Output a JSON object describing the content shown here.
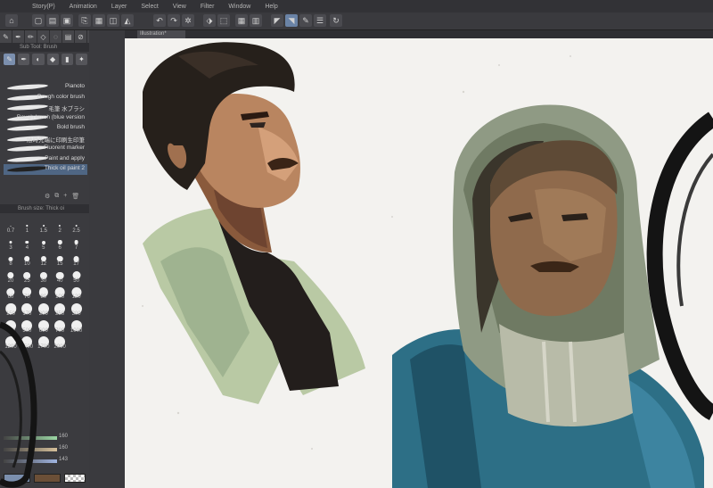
{
  "menu": [
    "Story(P)",
    "Animation",
    "Layer",
    "Select",
    "View",
    "Filter",
    "Window",
    "Help"
  ],
  "subtool_panel": {
    "header": "Sub Tool: Brush",
    "brushes": [
      {
        "label": "Pianoto",
        "selected": false
      },
      {
        "label": "Rough color brush",
        "selected": false
      },
      {
        "label": "毛筆 水ブラシ",
        "selected": false
      },
      {
        "label": "Rough brush (blue version",
        "selected": false
      },
      {
        "label": "Bold brush",
        "selected": false
      },
      {
        "label": "随時先端に印刷生印筆",
        "selected": false
      },
      {
        "label": "Fluorent marker",
        "selected": false
      },
      {
        "label": "Paint and apply",
        "selected": false
      },
      {
        "label": "Thick oil paint 2",
        "selected": true
      }
    ]
  },
  "size_panel": {
    "header": "Brush size: Thick oi",
    "sizes": [
      "0.7",
      "1",
      "1.5",
      "2",
      "2.5",
      "3",
      "4",
      "5",
      "6",
      "7",
      "8",
      "10",
      "12",
      "15",
      "17",
      "20",
      "25",
      "30",
      "40",
      "50",
      "60",
      "70",
      "80",
      "100",
      "120",
      "150",
      "170",
      "200",
      "250",
      "300",
      "400",
      "500",
      "600",
      "700",
      "1000",
      "1200",
      "1500",
      "1700",
      "2000"
    ]
  },
  "color_panel": {
    "sliders": [
      {
        "value": "160",
        "gradient": "#9ad6a3"
      },
      {
        "value": "160",
        "gradient": "#d6c09a"
      },
      {
        "value": "143",
        "gradient": "#a0b4e0"
      }
    ],
    "main_color": "#7b8fae",
    "sub_color": "#6b4f37"
  },
  "canvas": {
    "tab_label": "Illustration*"
  },
  "colors": {
    "ui_dark": "#2b2b2e",
    "ui_panel": "#3b3b3f",
    "accent": "#6a83a6",
    "canvas_bg": "#f3f2ef"
  }
}
